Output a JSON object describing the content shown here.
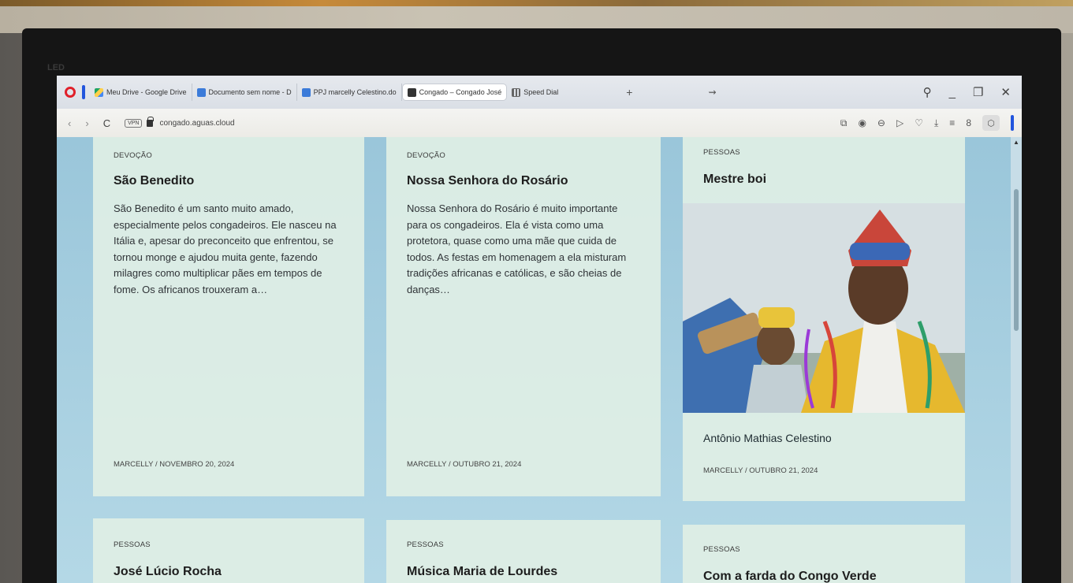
{
  "browser": {
    "tabs": [
      {
        "label": "Meu Drive - Google Drive",
        "icon": "google-drive-icon"
      },
      {
        "label": "Documento sem nome - D",
        "icon": "google-docs-icon"
      },
      {
        "label": "PPJ marcelly Celestino.do",
        "icon": "google-docs-icon"
      },
      {
        "label": "Congado – Congado José",
        "icon": "globe-icon",
        "active": true
      },
      {
        "label": "Speed Dial",
        "icon": "speed-dial-icon"
      }
    ],
    "new_tab": "+",
    "address": "congado.aguas.cloud",
    "vpn_label": "VPN",
    "brand_color": "#e0202a",
    "accent_color": "#2255dd"
  },
  "bezel": {
    "label": "LED"
  },
  "cards": [
    {
      "category": "DEVOÇÃO",
      "title": "São Benedito",
      "excerpt": "São Benedito é um santo muito amado, especialmente pelos congadeiros. Ele nasceu na Itália e, apesar do preconceito que enfrentou, se tornou monge e ajudou muita gente, fazendo milagres como multiplicar pães em tempos de fome. Os africanos trouxeram a…",
      "meta": "MARCELLY / NOVEMBRO 20, 2024"
    },
    {
      "category": "DEVOÇÃO",
      "title": "Nossa Senhora do Rosário",
      "excerpt": "Nossa Senhora do Rosário é muito importante para os congadeiros. Ela é vista como uma protetora, quase como uma mãe que cuida de todos. As festas em homenagem a ela misturam tradições africanas e católicas, e são cheias de danças…",
      "meta": "MARCELLY / OUTUBRO 21, 2024"
    },
    {
      "category": "PESSOAS",
      "title": "Mestre boi",
      "author": "Antônio Mathias Celestino",
      "meta": "MARCELLY / OUTUBRO 21, 2024"
    },
    {
      "category": "PESSOAS",
      "title": "José Lúcio Rocha"
    },
    {
      "category": "PESSOAS",
      "title": "Música Maria de Lourdes"
    },
    {
      "category": "PESSOAS",
      "title": "Com a farda do Congo Verde"
    }
  ]
}
